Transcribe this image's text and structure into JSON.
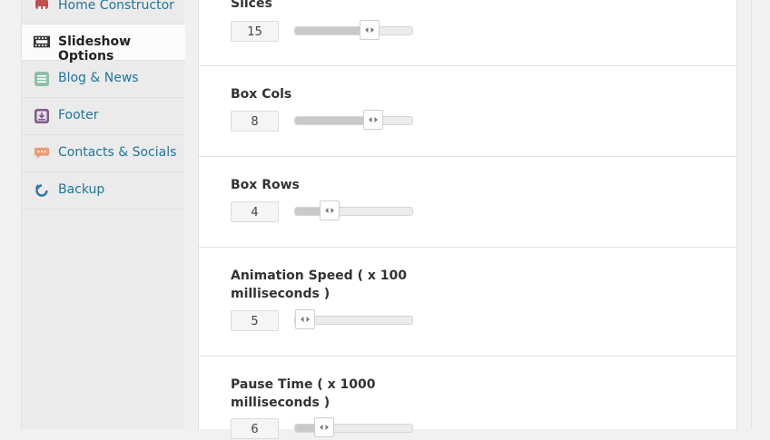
{
  "sidebar": {
    "items": [
      {
        "label": "Home Constructor",
        "icon": "home-constructor-icon",
        "active": false
      },
      {
        "label": "Slideshow Options",
        "icon": "film-strip-icon",
        "active": true
      },
      {
        "label": "Blog & News",
        "icon": "document-lines-icon",
        "active": false
      },
      {
        "label": "Footer",
        "icon": "download-tray-icon",
        "active": false
      },
      {
        "label": "Contacts & Socials",
        "icon": "speech-bubble-icon",
        "active": false
      },
      {
        "label": "Backup",
        "icon": "refresh-arrow-icon",
        "active": false
      }
    ]
  },
  "options": [
    {
      "label": "Slices",
      "value": "15",
      "level": 0.66
    },
    {
      "label": "Box Cols",
      "value": "8",
      "level": 0.7
    },
    {
      "label": "Box Rows",
      "value": "4",
      "level": 0.25
    },
    {
      "label": "Animation Speed ( x 100 milliseconds )",
      "value": "5",
      "level": 0.0
    },
    {
      "label": "Pause Time ( x 1000 milliseconds )",
      "value": "6",
      "level": 0.2
    }
  ],
  "colors": {
    "link": "#21759b",
    "home_icon": "#c0504d",
    "film_icon": "#333333",
    "blog_icon": "#8fbfa8",
    "footer_icon": "#7d5a86",
    "contacts_icon": "#e89c76",
    "backup_icon": "#2e75a8"
  }
}
